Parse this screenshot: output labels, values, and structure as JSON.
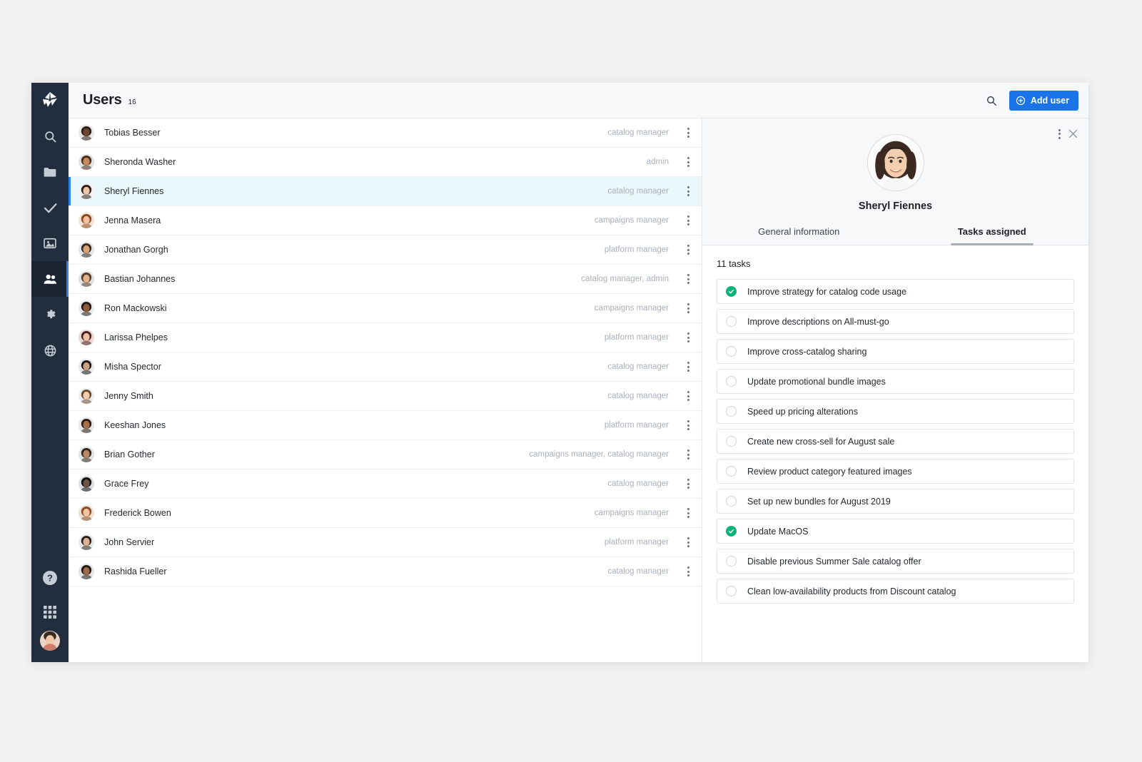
{
  "app": {
    "logo_icon": "origami-logo-icon"
  },
  "sidebar": {
    "items": [
      {
        "icon": "search-icon",
        "name": "sidebar-item-search",
        "active": false
      },
      {
        "icon": "folder-icon",
        "name": "sidebar-item-folders",
        "active": false
      },
      {
        "icon": "check-icon",
        "name": "sidebar-item-tasks",
        "active": false
      },
      {
        "icon": "image-icon",
        "name": "sidebar-item-media",
        "active": false
      },
      {
        "icon": "users-icon",
        "name": "sidebar-item-users",
        "active": true
      },
      {
        "icon": "gear-icon",
        "name": "sidebar-item-settings",
        "active": false
      },
      {
        "icon": "globe-icon",
        "name": "sidebar-item-global",
        "active": false
      }
    ],
    "bottom_items": [
      {
        "icon": "help-circle-icon",
        "name": "sidebar-item-help"
      },
      {
        "icon": "grid-apps-icon",
        "name": "sidebar-item-apps"
      }
    ],
    "account_avatar": "account-avatar"
  },
  "header": {
    "title": "Users",
    "count": "16",
    "search_icon": "search-icon",
    "add_user_label": "Add user",
    "add_user_icon": "plus-circle-icon"
  },
  "user_list": {
    "rows": [
      {
        "name": "Tobias Besser",
        "role": "catalog manager",
        "selected": false
      },
      {
        "name": "Sheronda Washer",
        "role": "admin",
        "selected": false
      },
      {
        "name": "Sheryl Fiennes",
        "role": "catalog manager",
        "selected": true
      },
      {
        "name": "Jenna Masera",
        "role": "campaigns manager",
        "selected": false
      },
      {
        "name": "Jonathan Gorgh",
        "role": "platform manager",
        "selected": false
      },
      {
        "name": "Bastian Johannes",
        "role": "catalog manager, admin",
        "selected": false
      },
      {
        "name": "Ron Mackowski",
        "role": "campaigns manager",
        "selected": false
      },
      {
        "name": "Larissa Phelpes",
        "role": "platform manager",
        "selected": false
      },
      {
        "name": "Misha Spector",
        "role": "catalog manager",
        "selected": false
      },
      {
        "name": "Jenny Smith",
        "role": "catalog manager",
        "selected": false
      },
      {
        "name": "Keeshan Jones",
        "role": "platform manager",
        "selected": false
      },
      {
        "name": "Brian Gother",
        "role": "campaigns manager, catalog manager",
        "selected": false
      },
      {
        "name": "Grace Frey",
        "role": "catalog manager",
        "selected": false
      },
      {
        "name": "Frederick Bowen",
        "role": "campaigns manager",
        "selected": false
      },
      {
        "name": "John Servier",
        "role": "platform manager",
        "selected": false
      },
      {
        "name": "Rashida Fueller",
        "role": "catalog manager",
        "selected": false
      }
    ],
    "row_menu_icon": "kebab-menu-icon"
  },
  "detail": {
    "avatar": "user-avatar",
    "name": "Sheryl Fiennes",
    "menu_icon": "kebab-menu-icon",
    "close_icon": "close-icon",
    "tabs": [
      {
        "label": "General information",
        "active": false
      },
      {
        "label": "Tasks assigned",
        "active": true
      }
    ],
    "task_count_label": "11 tasks",
    "tasks": [
      {
        "label": "Improve strategy for catalog code usage",
        "done": true
      },
      {
        "label": "Improve descriptions on All-must-go",
        "done": false
      },
      {
        "label": "Improve cross-catalog sharing",
        "done": false
      },
      {
        "label": "Update promotional bundle images",
        "done": false
      },
      {
        "label": "Speed up pricing alterations",
        "done": false
      },
      {
        "label": "Create new cross-sell for August sale",
        "done": false
      },
      {
        "label": "Review product category featured images",
        "done": false
      },
      {
        "label": "Set up new bundles for August 2019",
        "done": false
      },
      {
        "label": "Update MacOS",
        "done": true
      },
      {
        "label": "Disable previous Summer Sale catalog offer",
        "done": false
      },
      {
        "label": "Clean low-availability products from Discount catalog",
        "done": false
      }
    ]
  },
  "colors": {
    "sidebar_bg": "#222d3d",
    "sidebar_active_bg": "#1a2432",
    "accent_blue": "#2f80f7",
    "button_blue": "#1a73e8",
    "selected_row_bg": "#eaf7fb",
    "done_green": "#0bb27a",
    "role_text": "#a9b0bb",
    "topbar_bg": "#f7f8f9",
    "page_bg": "#f2f2f2"
  }
}
